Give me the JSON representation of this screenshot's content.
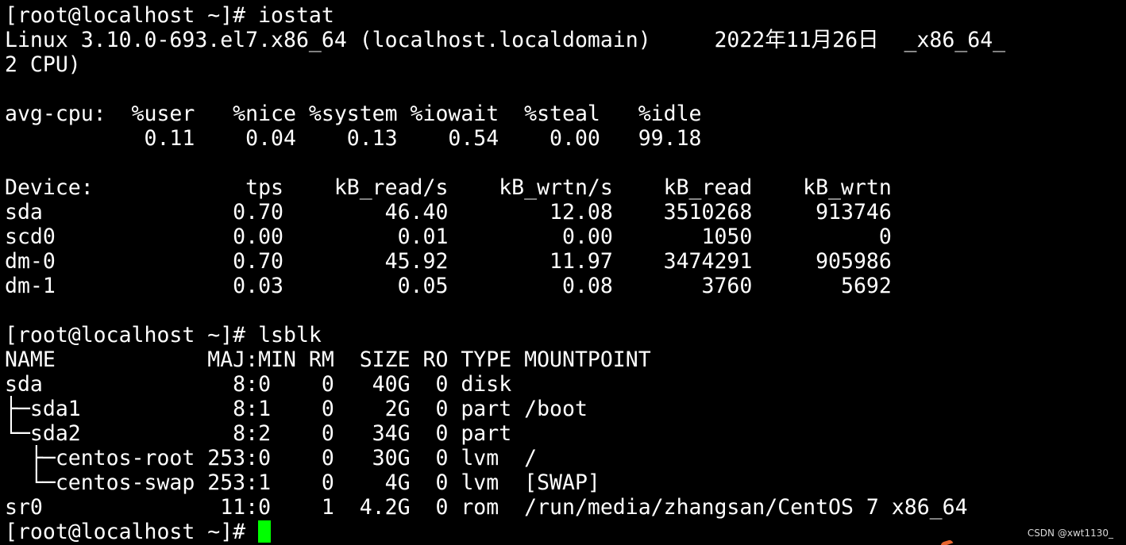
{
  "terminal": {
    "background": "#000000",
    "foreground": "#ffffff",
    "cursor_color": "#00ff00",
    "lines": [
      "[root@localhost ~]# iostat",
      "Linux 3.10.0-693.el7.x86_64 (localhost.localdomain)     2022年11月26日  _x86_64_",
      "2 CPU)",
      "",
      "avg-cpu:  %user   %nice %system %iowait  %steal   %idle",
      "           0.11    0.04    0.13    0.54    0.00   99.18",
      "",
      "Device:            tps    kB_read/s    kB_wrtn/s    kB_read    kB_wrtn",
      "sda               0.70        46.40        12.08    3510268     913746",
      "scd0              0.00         0.01         0.00       1050          0",
      "dm-0              0.70        45.92        11.97    3474291     905986",
      "dm-1              0.03         0.05         0.08       3760       5692",
      "",
      "[root@localhost ~]# lsblk",
      "NAME            MAJ:MIN RM  SIZE RO TYPE MOUNTPOINT",
      "sda               8:0    0   40G  0 disk",
      "├─sda1            8:1    0    2G  0 part /boot",
      "└─sda2            8:2    0   34G  0 part",
      "  ├─centos-root 253:0    0   30G  0 lvm  /",
      "  └─centos-swap 253:1    0    4G  0 lvm  [SWAP]",
      "sr0              11:0    1  4.2G  0 rom  /run/media/zhangsan/CentOS 7 x86_64"
    ],
    "prompt": "[root@localhost ~]# "
  },
  "watermark": "CSDN @xwt1130_"
}
